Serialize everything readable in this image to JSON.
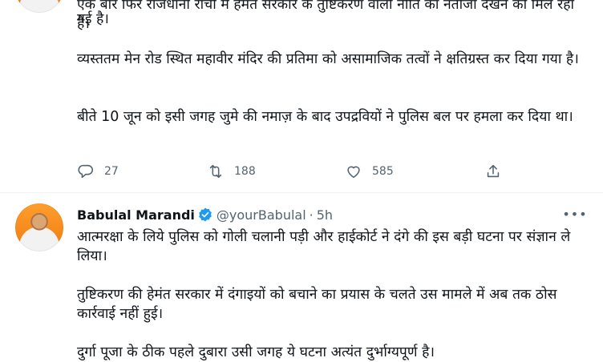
{
  "tweet1": {
    "partial_top": "एक बार फिर राजधानी रांची में हेमंत सरकार के तुष्टिकरण वाली नीति का नतीजा देखने को मिल रहा है।",
    "para_top_tail": "गई है।",
    "para1": "व्यस्ततम मेन रोड स्थित महावीर मंदिर की प्रतिमा को असामाजिक तत्वों ने क्षतिग्रस्त कर दिया गया है।",
    "para2": "बीते 10 जून को इसी जगह जुमे की नमाज़ के बाद उपद्रवियों ने पुलिस बल पर हमला कर दिया था।",
    "actions": {
      "replies": "27",
      "retweets": "188",
      "likes": "585"
    }
  },
  "tweet2": {
    "name": "Babulal Marandi",
    "handle": "@yourBabulal",
    "dot": "·",
    "time": "5h",
    "more": "•••",
    "para1": "आत्मरक्षा के लिये पुलिस को गोली चलानी पड़ी और हाईकोर्ट ने दंगे की इस बड़ी घटना पर संज्ञान ले लिया।",
    "para2": "तुष्टिकरण की हेमंत सरकार में दंगाइयों को बचाने का प्रयास के चलते उस मामले में अब तक ठोस कार्रवाई नहीं हुई।",
    "para3": "दुर्गा पूजा के ठीक पहले दुबारा उसी जगह ये घटना अत्यंत दुर्भाग्यपूर्ण है।"
  },
  "colors": {
    "text": "#0f1419",
    "secondary": "#536471",
    "verified": "#1d9bf0",
    "divider": "#eff3f4"
  },
  "icons": {
    "reply": "reply-icon",
    "retweet": "retweet-icon",
    "like": "heart-icon",
    "share": "share-icon",
    "verified": "verified-badge-icon",
    "more": "more-options-icon"
  }
}
